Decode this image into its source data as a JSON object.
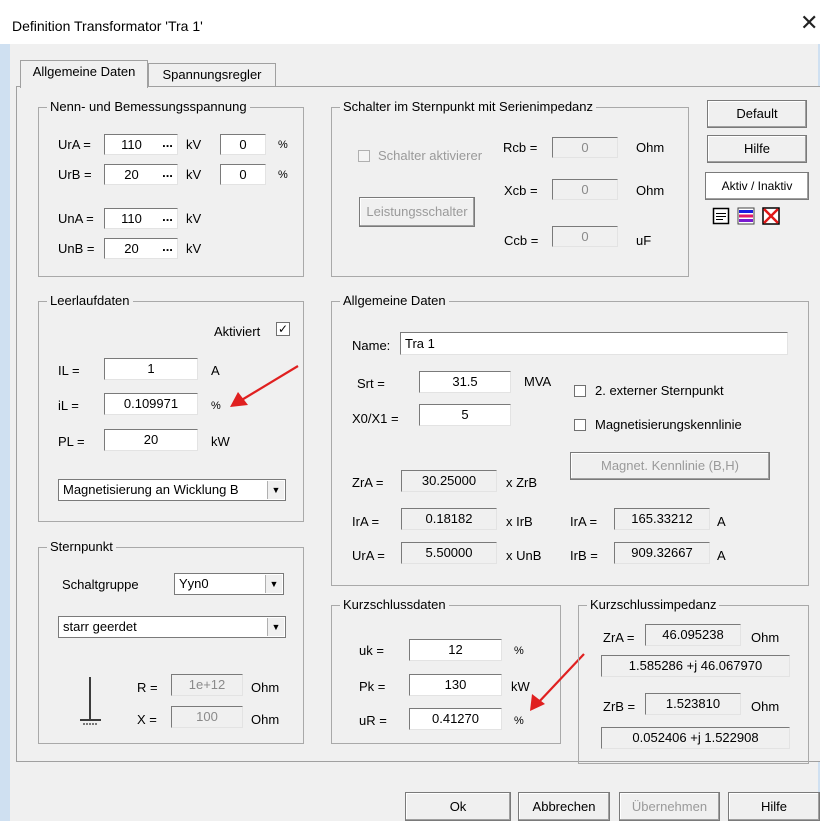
{
  "window": {
    "title": "Definition Transformator 'Tra 1'",
    "close_glyph": "✕"
  },
  "tabs": [
    {
      "label": "Allgemeine Daten"
    },
    {
      "label": "Spannungsregler"
    }
  ],
  "nenn": {
    "title": "Nenn- und Bemessungsspannung",
    "ura_label": "UrA =",
    "ura_value": "110",
    "ura_unit": "kV",
    "ura_pct": "0",
    "ura_pct_unit": "%",
    "urb_label": "UrB =",
    "urb_value": "20",
    "urb_unit": "kV",
    "urb_pct": "0",
    "urb_pct_unit": "%",
    "una_label": "UnA =",
    "una_value": "110",
    "una_unit": "kV",
    "unb_label": "UnB =",
    "unb_value": "20",
    "unb_unit": "kV",
    "dots": "..."
  },
  "schalter": {
    "title": "Schalter im Sternpunkt mit Serienimpedanz",
    "aktivieren_label": "Schalter aktivierer",
    "rcb_label": "Rcb =",
    "rcb_value": "0",
    "rcb_unit": "Ohm",
    "xcb_label": "Xcb =",
    "xcb_value": "0",
    "xcb_unit": "Ohm",
    "ccb_label": "Ccb =",
    "ccb_value": "0",
    "ccb_unit": "uF",
    "leistungsschalter_label": "Leistungsschalter"
  },
  "right_buttons": {
    "default_label": "Default",
    "hilfe_label": "Hilfe",
    "aktiv_label": "Aktiv / Inaktiv"
  },
  "leerlauf": {
    "title": "Leerlaufdaten",
    "aktiviert_label": "Aktiviert",
    "aktiviert_check": "✓",
    "il_label": "IL =",
    "il_value": "1",
    "il_unit": "A",
    "il_pct_label": "iL =",
    "il_pct_value": "0.109971",
    "il_pct_unit": "%",
    "pl_label": "PL =",
    "pl_value": "20",
    "pl_unit": "kW",
    "magnet_select": "Magnetisierung an Wicklung B"
  },
  "allgemein": {
    "title": "Allgemeine Daten",
    "name_label": "Name:",
    "name_value": "Tra 1",
    "srt_label": "Srt =",
    "srt_value": "31.5",
    "srt_unit": "MVA",
    "x0x1_label": "X0/X1 =",
    "x0x1_value": "5",
    "ext_sternpunkt_label": "2. externer Sternpunkt",
    "magnet_kennlinie_label": "Magnetisierungskennlinie",
    "magnet_button": "Magnet. Kennlinie (B,H)",
    "zra_label": "ZrA =",
    "zra_value": "30.25000",
    "zra_unit": "x ZrB",
    "ira_label": "IrA =",
    "ira_value": "0.18182",
    "ira_unit": "x IrB",
    "ura_label": "UrA =",
    "ura_value": "5.50000",
    "ura_unit": "x UnB",
    "ira2_label": "IrA =",
    "ira2_value": "165.33212",
    "ira2_unit": "A",
    "irb_label": "IrB =",
    "irb_value": "909.32667",
    "irb_unit": "A"
  },
  "sternpunkt": {
    "title": "Sternpunkt",
    "schaltgruppe_label": "Schaltgruppe",
    "schaltgruppe_value": "Yyn0",
    "erdung_value": "starr geerdet",
    "r_label": "R =",
    "r_value": "1e+12",
    "r_unit": "Ohm",
    "x_label": "X =",
    "x_value": "100",
    "x_unit": "Ohm"
  },
  "kurzschluss": {
    "title": "Kurzschlussdaten",
    "uk_label": "uk =",
    "uk_value": "12",
    "uk_unit": "%",
    "pk_label": "Pk =",
    "pk_value": "130",
    "pk_unit": "kW",
    "ur_label": "uR =",
    "ur_value": "0.41270",
    "ur_unit": "%"
  },
  "impedanz": {
    "title": "Kurzschlussimpedanz",
    "zra_label": "ZrA =",
    "zra_value": "46.095238",
    "zra_unit": "Ohm",
    "zra_complex": "1.585286 +j 46.067970",
    "zrb_label": "ZrB =",
    "zrb_value": "1.523810",
    "zrb_unit": "Ohm",
    "zrb_complex": "0.052406 +j 1.522908"
  },
  "bottom_buttons": {
    "ok": "Ok",
    "abbrechen": "Abbrechen",
    "uebernehmen": "Übernehmen",
    "hilfe": "Hilfe"
  },
  "colors": {
    "annotation_arrow": "#e02020",
    "title_bg": "#ffffff",
    "panel_bg": "#f0f0f0"
  }
}
